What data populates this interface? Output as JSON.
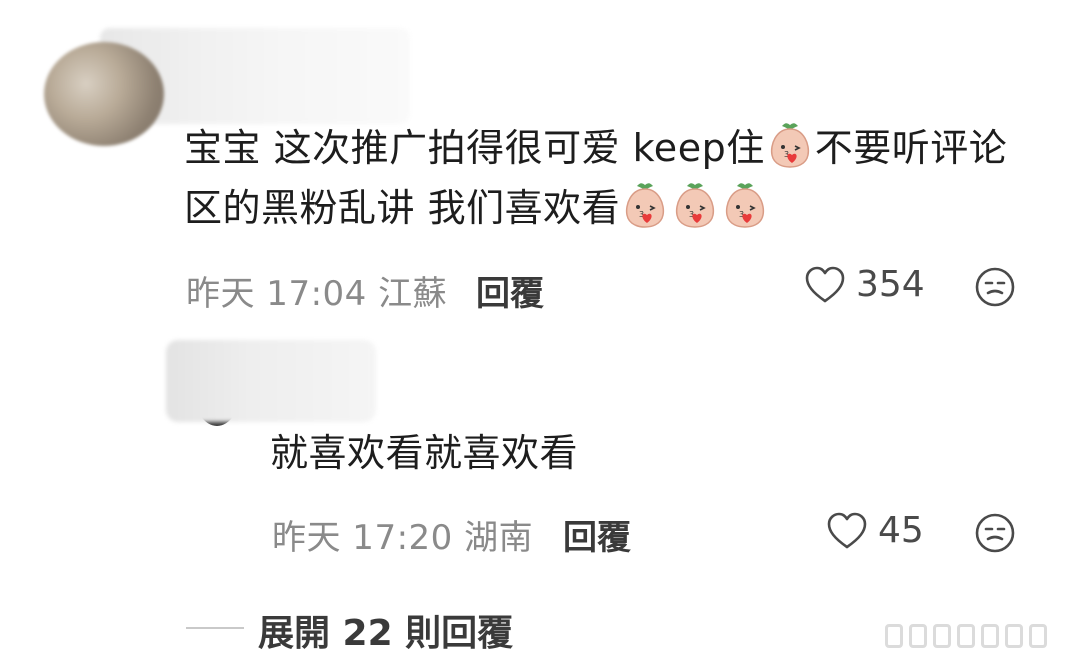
{
  "comment": {
    "text_parts": [
      "宝宝 这次推广拍得很可爱 keep住",
      "不要听评论区的黑粉乱讲 我们喜欢看"
    ],
    "emoji": "peach-blush-emoji",
    "meta": "昨天 17:04 江蘇",
    "reply_label": "回覆",
    "like_count": "354"
  },
  "reply": {
    "text": "就喜欢看就喜欢看",
    "meta": "昨天 17:20 湖南",
    "reply_label": "回覆",
    "like_count": "45"
  },
  "expand": {
    "label": "展開 22 則回覆"
  },
  "colors": {
    "text": "#1d1d1d",
    "meta": "#8a8a8a",
    "emoji_face": "#f3c9b6",
    "emoji_cheek": "#e83a3a",
    "emoji_leaf": "#5aa35a"
  }
}
